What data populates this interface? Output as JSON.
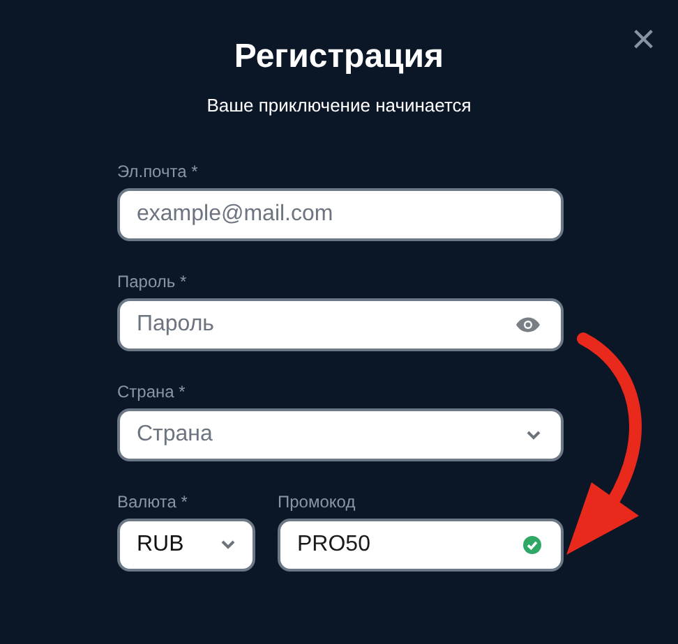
{
  "title": "Регистрация",
  "subtitle": "Ваше приключение начинается",
  "close": "×",
  "fields": [
    {
      "kind": "input",
      "label": "Эл.почта *",
      "placeholder": "example@mail.com"
    },
    {
      "kind": "password",
      "label": "Пароль *",
      "placeholder": "Пароль"
    },
    {
      "kind": "select",
      "label": "Страна *",
      "placeholder": "Страна"
    }
  ],
  "currency": {
    "label": "Валюта *",
    "value": "RUB"
  },
  "promo": {
    "label": "Промокод",
    "value": "PRO50",
    "valid": true
  }
}
